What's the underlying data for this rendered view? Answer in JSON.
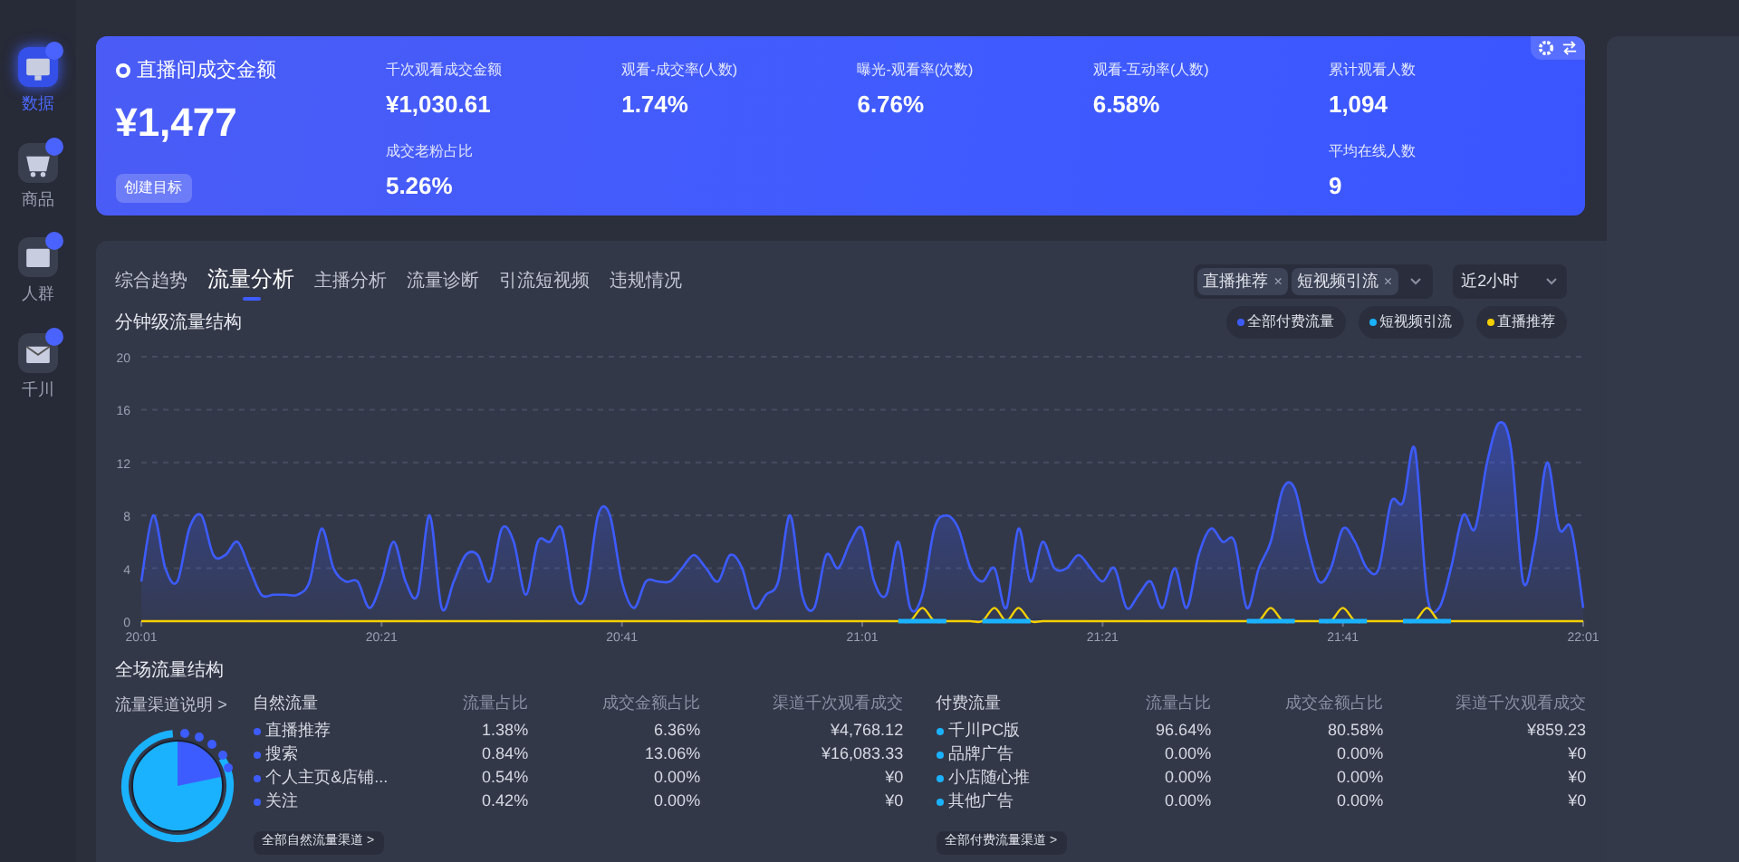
{
  "sidebar": {
    "items": [
      {
        "label": "数据",
        "selected": true
      },
      {
        "label": "商品",
        "selected": false
      },
      {
        "label": "人群",
        "selected": false
      },
      {
        "label": "千川",
        "selected": false
      }
    ]
  },
  "summary": {
    "title": "直播间成交金额",
    "value": "¥1,477",
    "button": "创建目标",
    "metric_columns": [
      {
        "metrics": [
          {
            "label": "千次观看成交金额",
            "value": "¥1,030.61"
          },
          {
            "label": "成交老粉占比",
            "value": "5.26%"
          }
        ]
      },
      {
        "metrics": [
          {
            "label": "观看-成交率(人数)",
            "value": "1.74%"
          }
        ]
      },
      {
        "metrics": [
          {
            "label": "曝光-观看率(次数)",
            "value": "6.76%"
          }
        ]
      },
      {
        "metrics": [
          {
            "label": "观看-互动率(人数)",
            "value": "6.58%"
          }
        ]
      },
      {
        "metrics": [
          {
            "label": "累计观看人数",
            "value": "1,094"
          },
          {
            "label": "平均在线人数",
            "value": "9"
          }
        ]
      }
    ]
  },
  "tabs": [
    {
      "label": "综合趋势",
      "selected": false
    },
    {
      "label": "流量分析",
      "selected": true
    },
    {
      "label": "主播分析",
      "selected": false
    },
    {
      "label": "流量诊断",
      "selected": false
    },
    {
      "label": "引流短视频",
      "selected": false
    },
    {
      "label": "违规情况",
      "selected": false
    }
  ],
  "filter": {
    "chips": [
      "直播推荐",
      "短视频引流"
    ],
    "close": "×",
    "period": "近2小时"
  },
  "minute_chart": {
    "title": "分钟级流量结构",
    "chart_data": {
      "type": "area",
      "grid": true,
      "ylim": [
        0,
        20
      ],
      "yticks": [
        0,
        4,
        8,
        12,
        16,
        20
      ],
      "categories": [
        "20:01",
        null,
        null,
        null,
        null,
        null,
        null,
        null,
        null,
        null,
        null,
        null,
        null,
        null,
        null,
        null,
        null,
        null,
        null,
        null,
        "20:21",
        null,
        null,
        null,
        null,
        null,
        null,
        null,
        null,
        null,
        null,
        null,
        null,
        null,
        null,
        null,
        null,
        null,
        null,
        null,
        "20:41",
        null,
        null,
        null,
        null,
        null,
        null,
        null,
        null,
        null,
        null,
        null,
        null,
        null,
        null,
        null,
        null,
        null,
        null,
        null,
        "21:01",
        null,
        null,
        null,
        null,
        null,
        null,
        null,
        null,
        null,
        null,
        null,
        null,
        null,
        null,
        null,
        null,
        null,
        null,
        null,
        "21:21",
        null,
        null,
        null,
        null,
        null,
        null,
        null,
        null,
        null,
        null,
        null,
        null,
        null,
        null,
        null,
        null,
        null,
        null,
        null,
        "21:41",
        null,
        null,
        null,
        null,
        null,
        null,
        null,
        null,
        null,
        null,
        null,
        null,
        null,
        null,
        null,
        null,
        null,
        null,
        null,
        "22:01"
      ],
      "series": [
        {
          "name": "全部付费流量",
          "color": "#3d5cff",
          "values": [
            3,
            8,
            4,
            3,
            7,
            8,
            5,
            5,
            6,
            4,
            2,
            2,
            2,
            2,
            3,
            7,
            4,
            3,
            3,
            1,
            3,
            6,
            3,
            2,
            8,
            1,
            3,
            5,
            5,
            3,
            7,
            6,
            2,
            6,
            6,
            7,
            2,
            2,
            8,
            8,
            3,
            1,
            3,
            3,
            3,
            4,
            5,
            4,
            3,
            5,
            4,
            1,
            2,
            3,
            8,
            2,
            1,
            5,
            4,
            6,
            7,
            3,
            2,
            6,
            1,
            2,
            7,
            8,
            7,
            4,
            3,
            4,
            1,
            7,
            3,
            6,
            4,
            4,
            5,
            4,
            3,
            4,
            1,
            2,
            3,
            1,
            4,
            1,
            5,
            7,
            6,
            6,
            1,
            4,
            6,
            10,
            10,
            6,
            3,
            4,
            7,
            6,
            4,
            4,
            9,
            9,
            13,
            2,
            1,
            4,
            8,
            7,
            12,
            15,
            13,
            3,
            6,
            12,
            7,
            7,
            1
          ]
        },
        {
          "name": "短视频引流",
          "color": "#1ab2ff",
          "type": "line",
          "values": [
            null,
            null,
            null,
            null,
            null,
            null,
            null,
            null,
            null,
            null,
            null,
            null,
            null,
            null,
            null,
            null,
            null,
            null,
            null,
            null,
            null,
            null,
            null,
            null,
            null,
            null,
            null,
            null,
            null,
            null,
            null,
            null,
            null,
            null,
            null,
            null,
            null,
            null,
            null,
            null,
            null,
            null,
            null,
            null,
            null,
            null,
            null,
            null,
            null,
            null,
            null,
            null,
            null,
            null,
            null,
            null,
            null,
            null,
            null,
            null,
            null,
            null,
            null,
            0,
            0,
            0,
            0,
            0,
            null,
            null,
            0,
            0,
            0,
            0,
            0,
            null,
            null,
            null,
            null,
            null,
            null,
            null,
            null,
            null,
            null,
            null,
            null,
            null,
            null,
            null,
            null,
            null,
            0,
            0,
            0,
            0,
            0,
            null,
            0,
            0,
            0,
            0,
            0,
            null,
            null,
            0,
            0,
            0,
            0,
            0,
            null,
            null,
            null,
            null,
            null,
            null,
            null,
            null,
            null,
            null,
            null
          ]
        },
        {
          "name": "直播推荐",
          "color": "#f5d000",
          "type": "line",
          "values": [
            0,
            0,
            0,
            0,
            0,
            0,
            0,
            0,
            0,
            0,
            0,
            0,
            0,
            0,
            0,
            0,
            0,
            0,
            0,
            0,
            0,
            0,
            0,
            0,
            0,
            0,
            0,
            0,
            0,
            0,
            0,
            0,
            0,
            0,
            0,
            0,
            0,
            0,
            0,
            0,
            0,
            0,
            0,
            0,
            0,
            0,
            0,
            0,
            0,
            0,
            0,
            0,
            0,
            0,
            0,
            0,
            0,
            0,
            0,
            0,
            0,
            0,
            0,
            0,
            0,
            1,
            0,
            0,
            0,
            0,
            0,
            1,
            0,
            1,
            0,
            0,
            0,
            0,
            0,
            0,
            0,
            0,
            0,
            0,
            0,
            0,
            0,
            0,
            0,
            0,
            0,
            0,
            0,
            0,
            1,
            0,
            0,
            0,
            0,
            0,
            1,
            0,
            0,
            0,
            0,
            0,
            0,
            1,
            0,
            0,
            0,
            0,
            0,
            0,
            0,
            0,
            0,
            0,
            0,
            0,
            0
          ]
        }
      ]
    }
  },
  "structure": {
    "title": "全场流量结构",
    "explain_link": "流量渠道说明 >",
    "tables": [
      {
        "kind": "natural",
        "columns": [
          "自然流量",
          "流量占比",
          "成交金额占比",
          "渠道千次观看成交"
        ],
        "rows": [
          [
            "直播推荐",
            "1.38%",
            "6.36%",
            "¥4,768.12"
          ],
          [
            "搜索",
            "0.84%",
            "13.06%",
            "¥16,083.33"
          ],
          [
            "个人主页&店铺...",
            "0.54%",
            "0.00%",
            "¥0"
          ],
          [
            "关注",
            "0.42%",
            "0.00%",
            "¥0"
          ]
        ],
        "more": "全部自然流量渠道 >"
      },
      {
        "kind": "paid",
        "columns": [
          "付费流量",
          "流量占比",
          "成交金额占比",
          "渠道千次观看成交"
        ],
        "rows": [
          [
            "千川PC版",
            "96.64%",
            "80.58%",
            "¥859.23"
          ],
          [
            "品牌广告",
            "0.00%",
            "0.00%",
            "¥0"
          ],
          [
            "小店随心推",
            "0.00%",
            "0.00%",
            "¥0"
          ],
          [
            "其他广告",
            "0.00%",
            "0.00%",
            "¥0"
          ]
        ],
        "more": "全部付费流量渠道 >"
      }
    ]
  }
}
